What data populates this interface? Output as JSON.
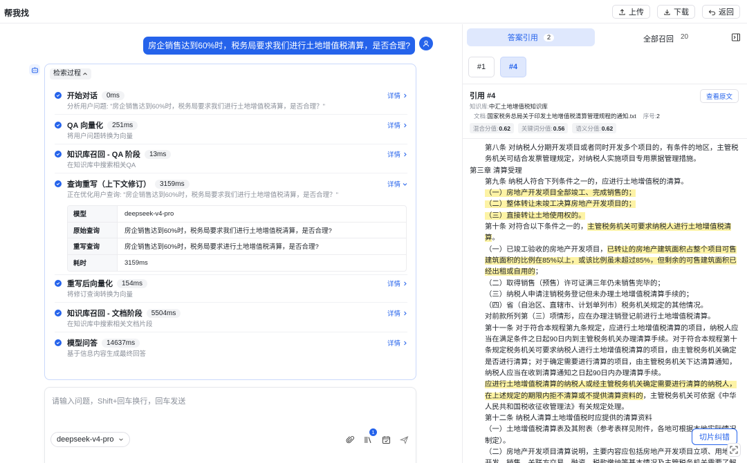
{
  "header": {
    "title": "帮我找",
    "buttons": {
      "upload": "上传",
      "download": "下载",
      "back": "返回"
    }
  },
  "chat": {
    "user_message": "房企销售达到60%时，税务局要求我们进行土地增值税清算，是否合理?",
    "process": {
      "toggle_label": "检索过程",
      "detail_label": "详情",
      "steps": [
        {
          "name": "开始对话",
          "time": "0ms",
          "desc": "分析用户问题: \"房企销售达到60%时，税务局要求我们进行土地增值税清算，是否合理？\""
        },
        {
          "name": "QA 向量化",
          "time": "251ms",
          "desc": "将用户问题转换为向量"
        },
        {
          "name": "知识库召回 - QA 阶段",
          "time": "13ms",
          "desc": "在知识库中搜索相关QA"
        },
        {
          "name": "查询重写（上下文修订）",
          "time": "3159ms",
          "desc": "正在优化用户查询: \"房企销售达到60%时，税务局要求我们进行土地增值税清算，是否合理？\""
        },
        {
          "name": "重写后向量化",
          "time": "154ms",
          "desc": "将修订查询转换为向量"
        },
        {
          "name": "知识库召回 - 文档阶段",
          "time": "5504ms",
          "desc": "在知识库中搜索相关文档片段"
        },
        {
          "name": "模型问答",
          "time": "14637ms",
          "desc": "基于信息内容生成最终回答"
        }
      ],
      "rewrite_table": [
        {
          "key": "模型",
          "value": "deepseek-v4-pro"
        },
        {
          "key": "原始查询",
          "value": "房企销售达到60%时，税务局要求我们进行土地增值税清算，是否合理?"
        },
        {
          "key": "重写查询",
          "value": "房企销售达到60%时，税务局要求进行土地增值税清算，是否合理?"
        },
        {
          "key": "耗时",
          "value": "3159ms"
        }
      ]
    },
    "input": {
      "placeholder": "请输入问题，Shift+回车换行，回车发送",
      "model": "deepseek-v4-pro",
      "kb_badge": "1"
    }
  },
  "citations": {
    "tab_answer": "答案引用",
    "tab_answer_count": "2",
    "tab_all": "全部召回",
    "tab_all_count": "20",
    "cite_tabs": [
      "#1",
      "#4"
    ],
    "active_cite": "#4",
    "title": "引用 #4",
    "view_original": "查看原文",
    "kb_label": "知识库:",
    "kb_name": "中汇土地增值税知识库",
    "file_label": "文档:",
    "file_name": "国家税务总局关于印发土地增值税清算管理规程的通知.txt",
    "seq_label": "序号:",
    "seq": "2",
    "scores": [
      {
        "label": "混合分值:",
        "value": "0.62"
      },
      {
        "label": "关键词分值:",
        "value": "0.56"
      },
      {
        "label": "语义分值:",
        "value": "0.62"
      }
    ],
    "fix_button": "切片纠错"
  },
  "doc_lines": {
    "l1": "第八条 对纳税人分期开发项目或者同时开发多个项目的，有条件的地区，主管税务机关可结合发票管理规定，对纳税人实施项目专用票据管理措施。",
    "l2": "第三章 清算受理",
    "l3": "第九条 纳税人符合下列条件之一的，应进行土地增值税的清算。",
    "l4": "（一）房地产开发项目全部竣工、完成销售的；",
    "l5": "（二）整体转让未竣工决算房地产开发项目的；",
    "l6": "（三）直接转让土地使用权的。",
    "l7a": "第十条 对符合以下条件之一的，",
    "l7b": "主管税务机关可要求纳税人进行土地增值税清算",
    "l7c": "。",
    "l8a": "（一）已竣工验收的房地产开发项目，",
    "l8b": "已转让的房地产建筑面积占整个项目可售建筑面积的比例在85%以上，或该比例虽未超过85%，但剩余的可售建筑面积已经出租或自用的",
    "l8c": "；",
    "l9": "（二）取得销售（预售）许可证满三年仍未销售完毕的；",
    "l10": "（三）纳税人申请注销税务登记但未办理土地增值税清算手续的；",
    "l11": "（四）省（自治区、直辖市、计划单列市）税务机关规定的其他情况。",
    "l12": "对前款所列第（三）项情形，应在办理注销登记前进行土地增值税清算。",
    "l13": "第十一条 对于符合本规程第九条规定，应进行土地增值税清算的项目，纳税人应当在满足条件之日起90日内到主管税务机关办理清算手续。对于符合本规程第十条规定税务机关可要求纳税人进行土地增值税清算的项目，由主管税务机关确定是否进行清算；对于确定需要进行清算的项目，由主管税务机关下达清算通知，纳税人应当在收到清算通知之日起90日内办理清算手续。",
    "l14a": "应进行土地增值税清算的纳税人或经主管税务机关确定需要进行清算的纳税人，在上述规定的期限内拒不清算或不提供清算资料的",
    "l14b": "，主管税务机关可依据《中华人民共和国税收征收管理法》有关规定处理。",
    "l15": "第十二条 纳税人清算土地增值税时应提供的清算资料",
    "l16": "（一）土地增值税清算表及其附表（参考表样见附件，各地可根据本地实际情况制定）。",
    "l17": "（二）房地产开发项目清算说明，主要内容应包括房地产开发项目立项、用地、开发、销售、关联方交易、融资、税款缴纳等基本情况及主管税务机关需要了解的其他情况。"
  }
}
